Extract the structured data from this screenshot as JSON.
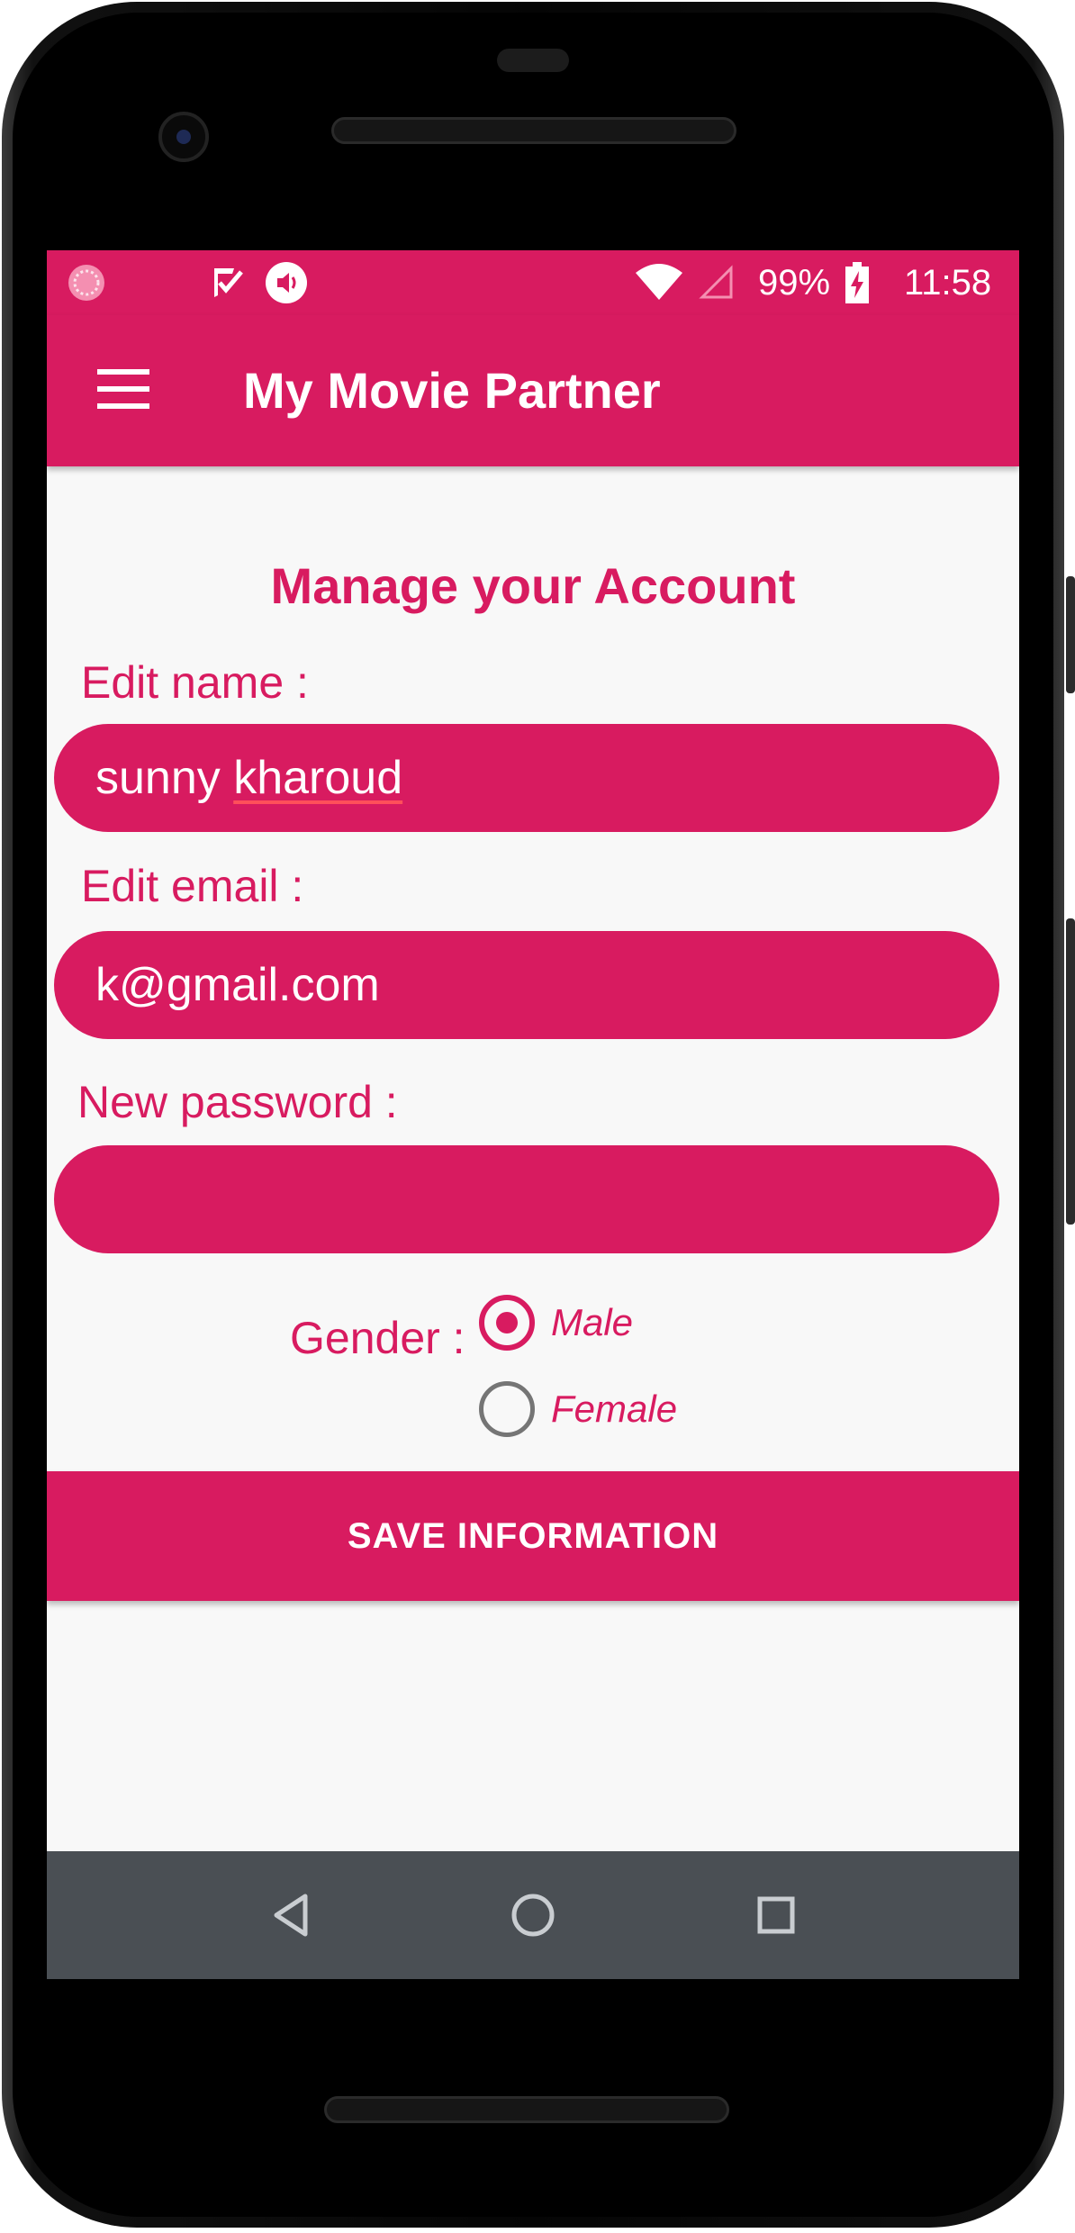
{
  "status_bar": {
    "battery": "99%",
    "time": "11:58",
    "icons": [
      "sync-icon",
      "check-notification-icon",
      "volume-notification-icon",
      "wifi-icon",
      "cell-signal-icon",
      "battery-charging-icon"
    ]
  },
  "app_bar": {
    "title": "My Movie Partner",
    "menu_icon": "hamburger-menu-icon"
  },
  "main": {
    "heading": "Manage your Account",
    "name": {
      "label": "Edit name :",
      "value_first": "sunny",
      "value_second": "kharoud"
    },
    "email": {
      "label": "Edit email :",
      "value": "k@gmail.com"
    },
    "password": {
      "label": "New password :",
      "value": ""
    },
    "gender": {
      "label": "Gender :",
      "options": [
        {
          "label": "Male",
          "selected": true
        },
        {
          "label": "Female",
          "selected": false
        }
      ]
    },
    "save_label": "SAVE INFORMATION"
  },
  "nav_bar": {
    "icons": [
      "back-icon",
      "home-icon",
      "recents-icon"
    ]
  },
  "colors": {
    "accent": "#d81b60",
    "nav_bar": "#4a4f54",
    "background": "#f8f8f8"
  }
}
